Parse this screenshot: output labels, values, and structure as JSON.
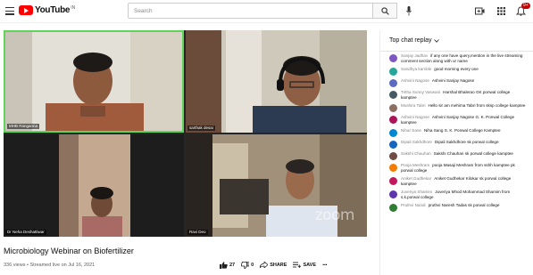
{
  "header": {
    "logo_text": "YouTube",
    "logo_sup": "IN",
    "search_placeholder": "Search",
    "notification_count": "9+",
    "icons": [
      "menu-icon",
      "search-icon",
      "mic-icon",
      "create-video-icon",
      "apps-icon",
      "bell-icon"
    ]
  },
  "video": {
    "title": "Microbiology Webinar on Biofertilizer",
    "meta": "336 views • Streamed live on Jul 16, 2021",
    "participants": [
      {
        "label": "MHB Ranganna"
      },
      {
        "label": "sarthak desai"
      },
      {
        "label": "Dr Neha Deshattiwar"
      },
      {
        "label": "Ravi Deo"
      }
    ],
    "zoom_watermark": "zoom",
    "actions": {
      "like_count": "27",
      "dislike_count": "0",
      "share_label": "SHARE",
      "save_label": "SAVE"
    }
  },
  "chat": {
    "header": "Top chat replay",
    "messages": [
      {
        "author": "Sanjay Jadhav",
        "text": "if any one have query,mention in the live streaming comment section along with ur name",
        "color": "#7e57c2"
      },
      {
        "author": "Sandhya kamble",
        "text": "good morning every one",
        "color": "#26a69a"
      },
      {
        "author": "Ashvini Nagose",
        "text": "Ashvini Sanjay Nagose",
        "color": "#5c6bc0"
      },
      {
        "author": "Tirtha Sunny Vaswani",
        "text": "Harshal Bhalerao GK ponwal college kamptee",
        "color": "#455a64"
      },
      {
        "author": "Mushira Tabri",
        "text": "Hello sir am mehima Tabri from sksp college kamptee",
        "color": "#8d6e63"
      },
      {
        "author": "Ashvini Nagose",
        "text": "Ashvini Sanjay Nagose G. K. Ponwal College kamptee",
        "color": "#ad1457"
      },
      {
        "author": "Nihar Sane",
        "text": "Niha Sang S. K. Ponwal College Kamptee",
        "color": "#0288d1"
      },
      {
        "author": "Dipali Sakhdhore",
        "text": "Dipali Sakhdhore sk porwal college",
        "color": "#1565c0"
      },
      {
        "author": "Sakshi Chauhan",
        "text": "Sakshi Chauhan sk porwal college kamptee",
        "color": "#6d4c41"
      },
      {
        "author": "Pooja Meshram",
        "text": "pooja Masaji Meshram from sshh kamptee pk porwal college",
        "color": "#f57c00"
      },
      {
        "author": "Aniket Gudhekar",
        "text": "Aniket Gudhekar Kilokar sk porwal college kamptee",
        "color": "#c2185b"
      },
      {
        "author": "Juveriya Shamim",
        "text": "Juveriya Mhod Mohammad Shamim from s.k.porwal college",
        "color": "#5e35b1"
      },
      {
        "author": "Pruthvi Nandi",
        "text": "pruthvi Naresh Tadas sk porwal college",
        "color": "#2e7d32"
      }
    ]
  }
}
